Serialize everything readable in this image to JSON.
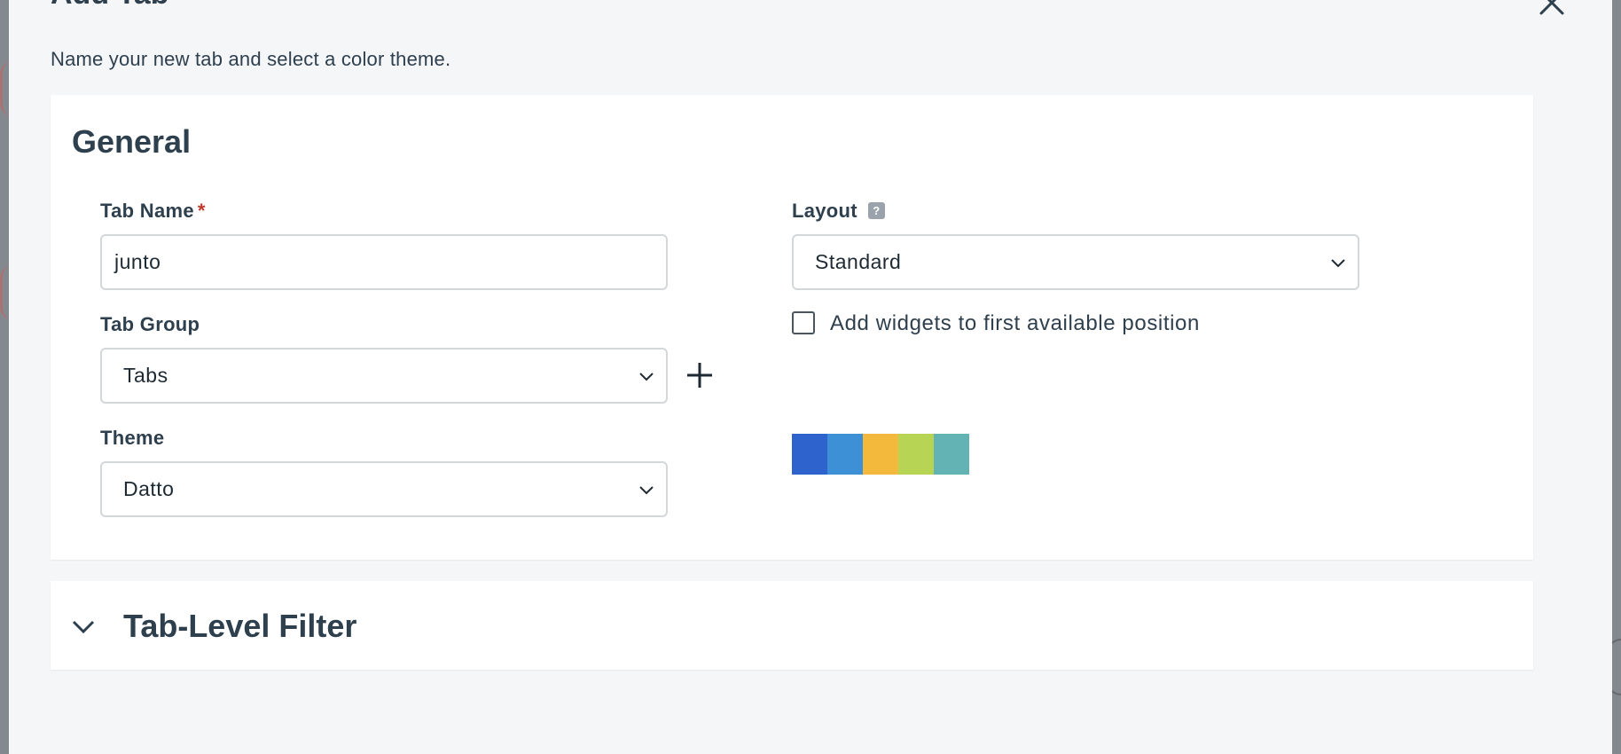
{
  "modal": {
    "title": "Add Tab",
    "subtitle": "Name your new tab and select a color theme."
  },
  "general": {
    "title": "General",
    "tab_name": {
      "label": "Tab Name",
      "required_mark": "*",
      "value": "junto"
    },
    "tab_group": {
      "label": "Tab Group",
      "selected": "Tabs"
    },
    "theme": {
      "label": "Theme",
      "selected": "Datto",
      "swatch_colors": [
        "#2e62cc",
        "#3d8fd6",
        "#f3b93c",
        "#b8d455",
        "#63b3b5"
      ]
    },
    "layout": {
      "label": "Layout",
      "help": "?",
      "selected": "Standard"
    },
    "auto_position": {
      "label": "Add widgets to first available position",
      "checked": false
    }
  },
  "filter": {
    "title": "Tab-Level Filter"
  },
  "icons": {
    "close": "close-icon",
    "chevron": "chevron-down-icon",
    "plus": "plus-icon"
  }
}
